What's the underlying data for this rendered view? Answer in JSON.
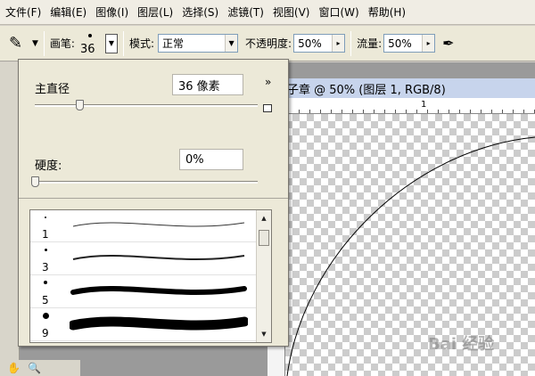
{
  "menubar": {
    "items": [
      "文件(F)",
      "编辑(E)",
      "图像(I)",
      "图层(L)",
      "选择(S)",
      "滤镜(T)",
      "视图(V)",
      "窗口(W)",
      "帮助(H)"
    ]
  },
  "options": {
    "brush_label": "画笔:",
    "brush_size": "36",
    "mode_label": "模式:",
    "mode_value": "正常",
    "opacity_label": "不透明度:",
    "opacity_value": "50%",
    "flow_label": "流量:",
    "flow_value": "50%"
  },
  "document": {
    "title": "子章 @ 50% (图层 1, RGB/8)",
    "ruler_mark": "1"
  },
  "brush_popup": {
    "diameter_label": "主直径",
    "diameter_value": "36 像素",
    "diameter_level": 0.2,
    "hardness_label": "硬度:",
    "hardness_value": "0%",
    "hardness_level": 0.0,
    "presets": [
      {
        "size": "1"
      },
      {
        "size": "3"
      },
      {
        "size": "5"
      },
      {
        "size": "9"
      }
    ]
  },
  "watermark": "Bai 经验",
  "colors": {
    "menubar_bg": "#f0ede4",
    "title_bg": "#c7d4ec",
    "panel_bg": "#ece9d8"
  }
}
